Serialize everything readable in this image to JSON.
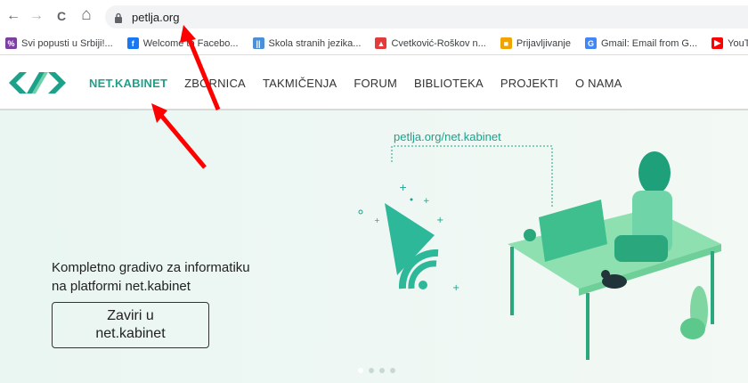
{
  "browser": {
    "url": "petlja.org",
    "back_icon": "←",
    "forward_icon": "→",
    "reload_icon": "C",
    "home_icon": "⌂"
  },
  "bookmarks": [
    {
      "label": "Svi popusti u Srbiji!...",
      "color": "#7b3fa0",
      "glyph": "%"
    },
    {
      "label": "Welcome to Facebo...",
      "color": "#1877f2",
      "glyph": "f"
    },
    {
      "label": "Skola stranih jezika...",
      "color": "#4a90d9",
      "glyph": "||"
    },
    {
      "label": "Cvetković-Roškov n...",
      "color": "#e33a3a",
      "glyph": "▲"
    },
    {
      "label": "Prijavljivanje",
      "color": "#f0a400",
      "glyph": "■"
    },
    {
      "label": "Gmail: Email from G...",
      "color": "#4285f4",
      "glyph": "G"
    },
    {
      "label": "YouTub",
      "color": "#ff0000",
      "glyph": "▶"
    }
  ],
  "site": {
    "menu": [
      {
        "label": "NET.KABINET",
        "active": true
      },
      {
        "label": "ZBORNICA",
        "active": false
      },
      {
        "label": "TAKMIČENJA",
        "active": false
      },
      {
        "label": "FORUM",
        "active": false
      },
      {
        "label": "BIBLIOTEKA",
        "active": false
      },
      {
        "label": "PROJEKTI",
        "active": false
      },
      {
        "label": "O NAMA",
        "active": false
      }
    ],
    "brand_color": "#1ca28a"
  },
  "hero": {
    "url_tag": "petlja.org/net.kabinet",
    "text_line1": "Kompletno gradivo za informatiku",
    "text_line2": "na platformi net.kabinet",
    "cta_line1": "Zaviri u",
    "cta_line2": "net.kabinet",
    "carousel_dots": 4,
    "active_dot": 0
  }
}
